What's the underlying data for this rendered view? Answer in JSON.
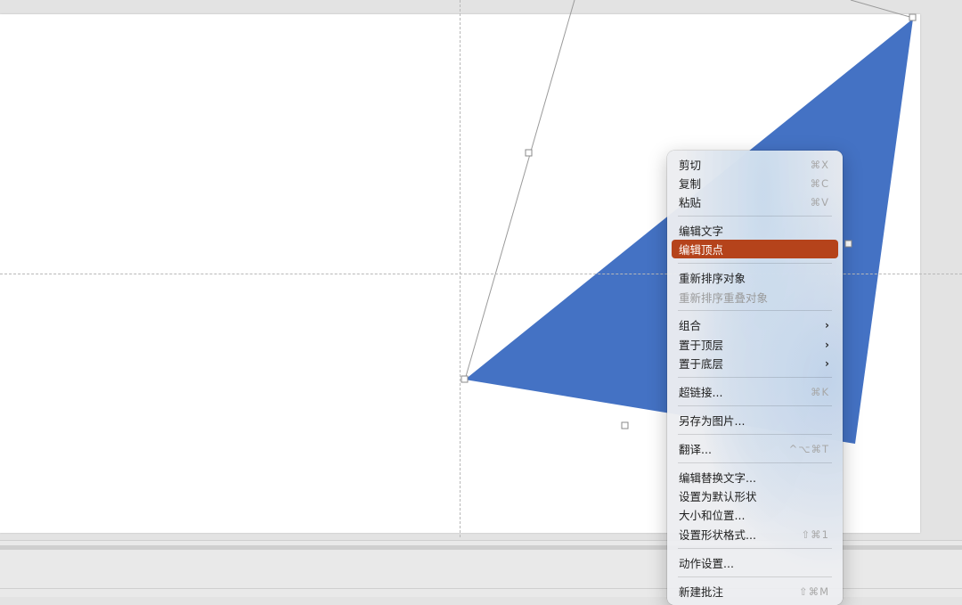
{
  "context_menu": {
    "items": [
      {
        "label": "剪切",
        "shortcut": "⌘X"
      },
      {
        "label": "复制",
        "shortcut": "⌘C"
      },
      {
        "label": "粘贴",
        "shortcut": "⌘V"
      },
      {
        "label": "编辑文字"
      },
      {
        "label": "编辑顶点",
        "highlighted": true
      },
      {
        "label": "重新排序对象"
      },
      {
        "label": "重新排序重叠对象",
        "disabled": true
      },
      {
        "label": "组合",
        "submenu": true
      },
      {
        "label": "置于顶层",
        "submenu": true
      },
      {
        "label": "置于底层",
        "submenu": true
      },
      {
        "label": "超链接...",
        "shortcut": "⌘K"
      },
      {
        "label": "另存为图片..."
      },
      {
        "label": "翻译...",
        "shortcut": "^⌥⌘T"
      },
      {
        "label": "编辑替换文字..."
      },
      {
        "label": "设置为默认形状"
      },
      {
        "label": "大小和位置..."
      },
      {
        "label": "设置形状格式...",
        "shortcut": "⇧⌘1"
      },
      {
        "label": "动作设置..."
      },
      {
        "label": "新建批注",
        "shortcut": "⇧⌘M"
      }
    ],
    "submenu_arrow": "›",
    "highlight_color": "#B5431B"
  },
  "shape": {
    "type": "triangle",
    "fill_color": "#4472C4"
  }
}
